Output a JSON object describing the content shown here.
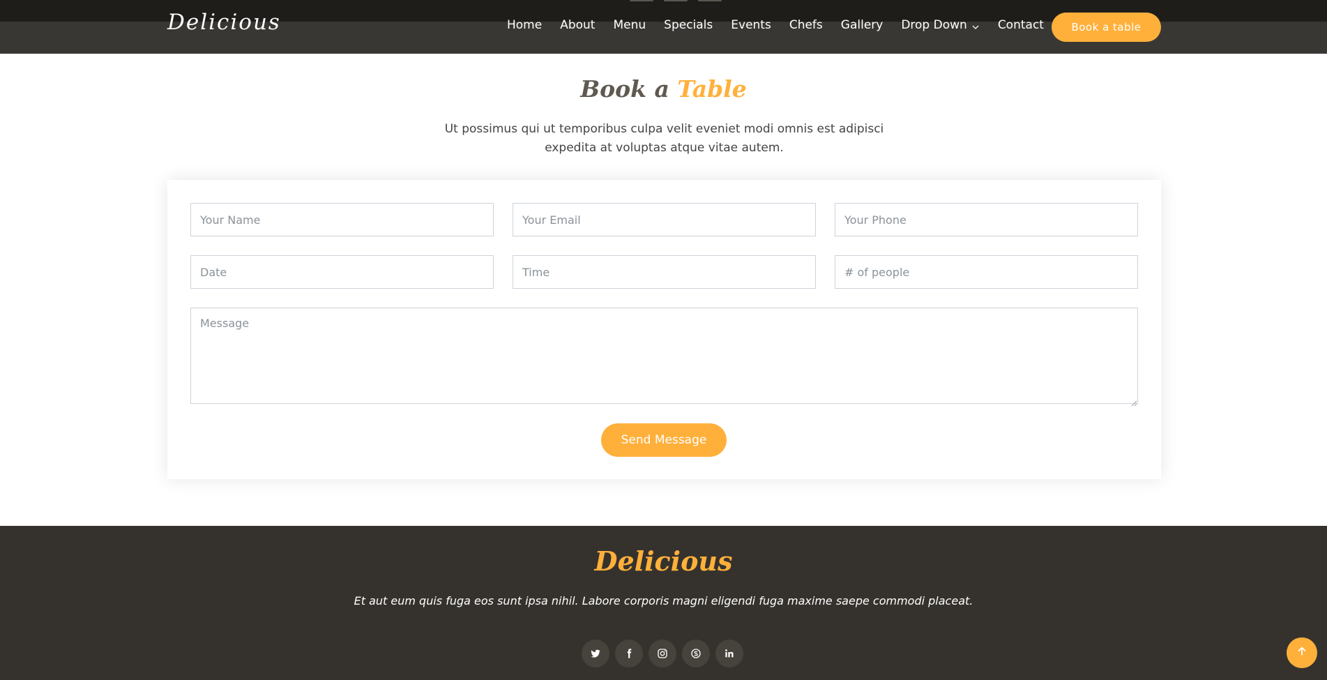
{
  "brand": {
    "name": "Delicious",
    "accent_color": "#ffb03b",
    "footer_bg": "#35322d"
  },
  "nav": {
    "items": [
      {
        "label": "Home"
      },
      {
        "label": "About"
      },
      {
        "label": "Menu"
      },
      {
        "label": "Specials"
      },
      {
        "label": "Events"
      },
      {
        "label": "Chefs"
      },
      {
        "label": "Gallery"
      },
      {
        "label": "Drop Down",
        "icon": "chevron-down-icon"
      },
      {
        "label": "Contact"
      }
    ],
    "cta_label": "Book a table"
  },
  "section": {
    "title_main": "Book a ",
    "title_accent": "Table",
    "subtitle": "Ut possimus qui ut temporibus culpa velit eveniet modi omnis est adipisci expedita at voluptas atque vitae autem."
  },
  "form": {
    "name_placeholder": "Your Name",
    "email_placeholder": "Your Email",
    "phone_placeholder": "Your Phone",
    "date_placeholder": "Date",
    "time_placeholder": "Time",
    "people_placeholder": "# of people",
    "message_placeholder": "Message",
    "submit_label": "Send Message"
  },
  "footer": {
    "logo": "Delicious",
    "tagline": "Et aut eum quis fuga eos sunt ipsa nihil. Labore corporis magni eligendi fuga maxime saepe commodi placeat.",
    "socials": [
      "twitter-icon",
      "facebook-icon",
      "instagram-icon",
      "skype-icon",
      "linkedin-icon"
    ]
  },
  "back_to_top_icon": "arrow-up-icon"
}
